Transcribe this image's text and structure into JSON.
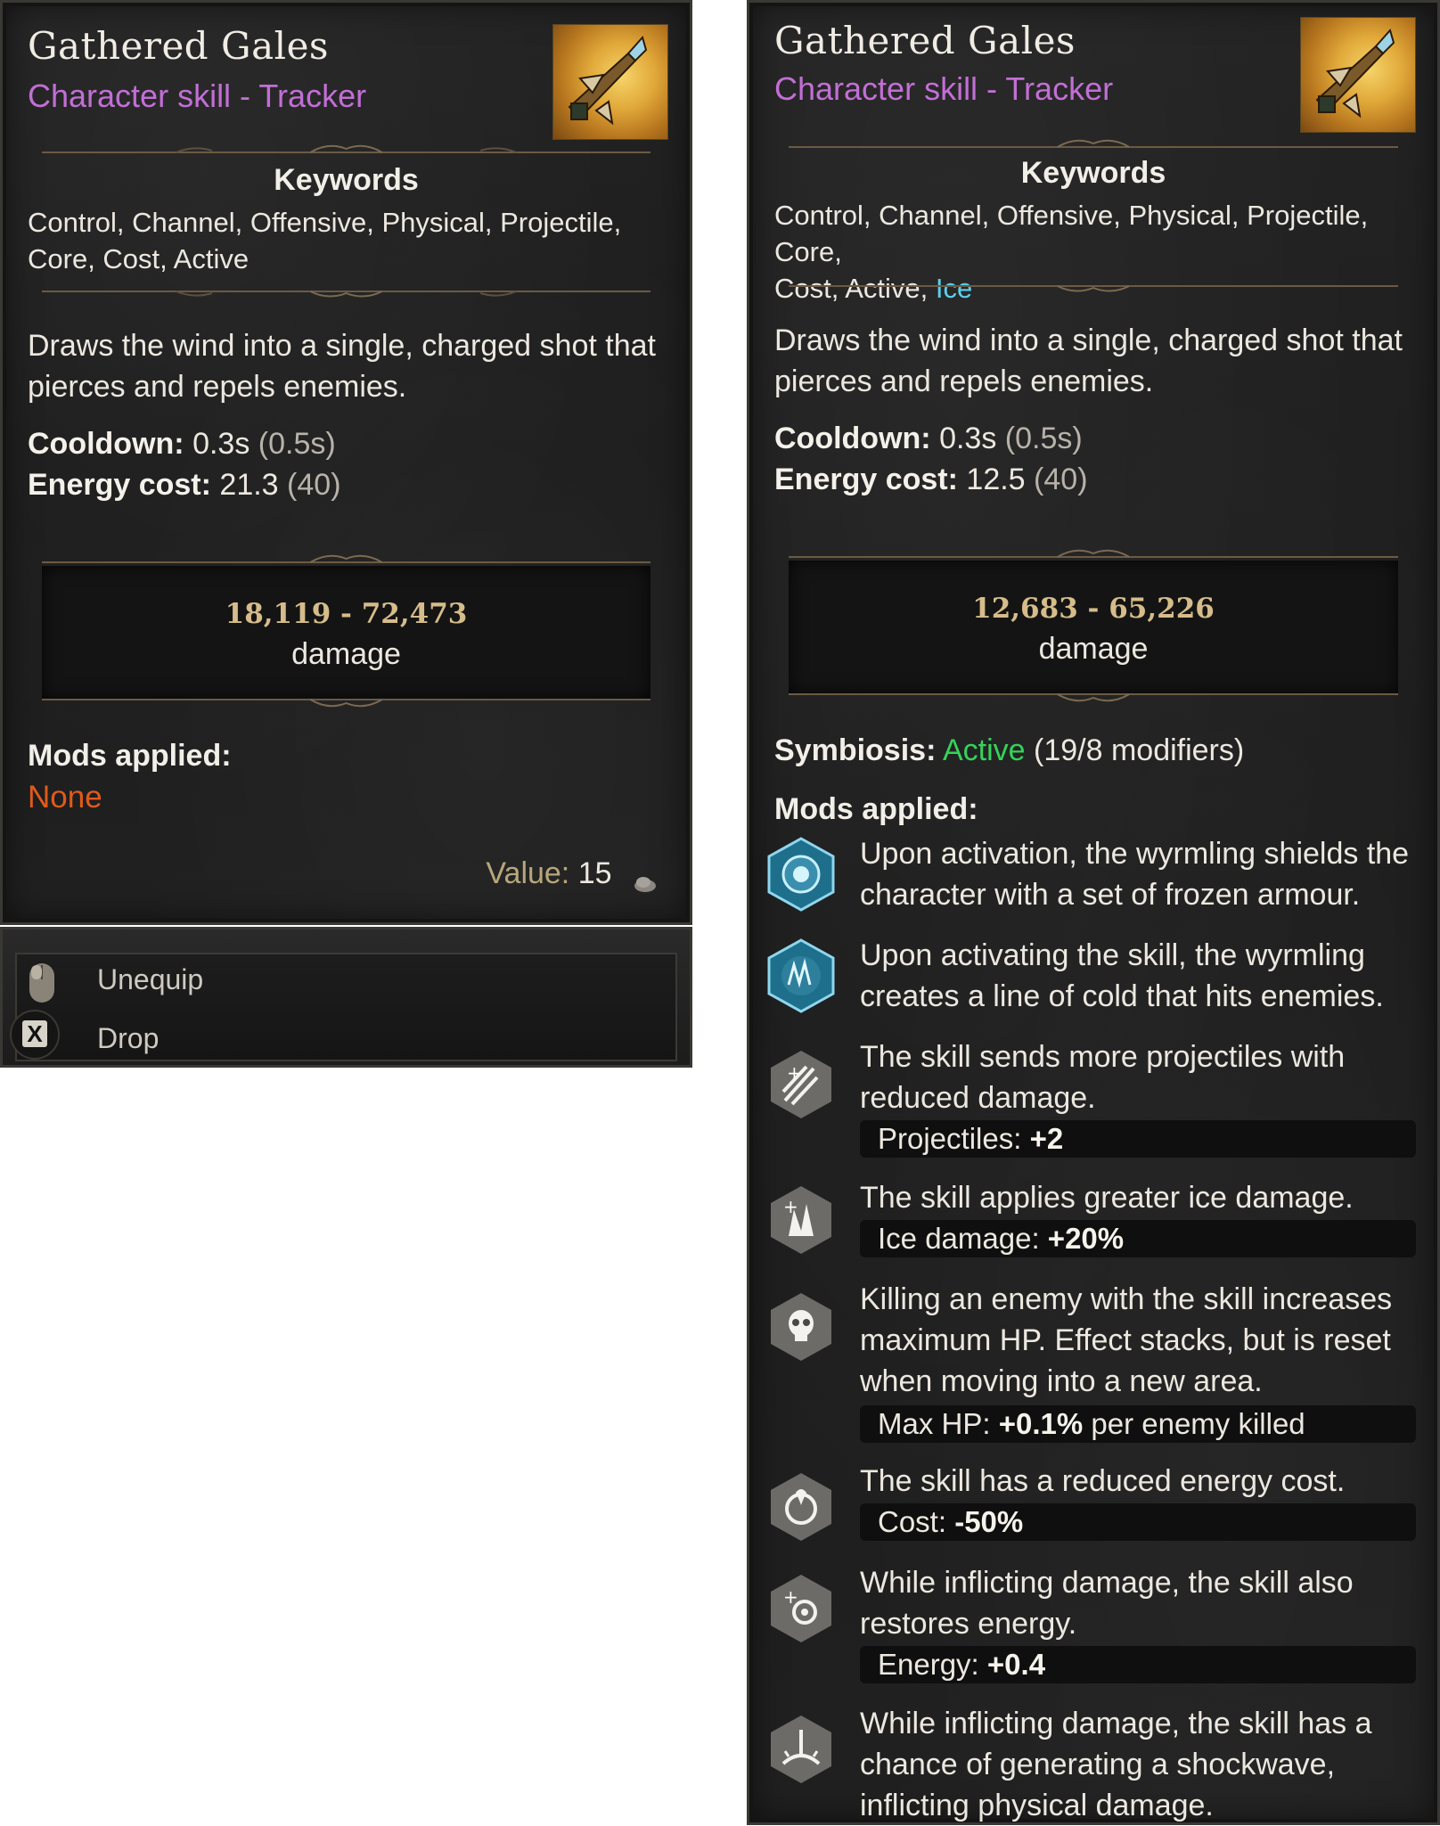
{
  "left_panel": {
    "title": "Gathered Gales",
    "subtitle": "Character skill - Tracker",
    "keywords_heading": "Keywords",
    "keywords": "Control, Channel, Offensive, Physical, Projectile, Core, Cost, Active",
    "description": "Draws the wind into a single, charged shot that pierces and repels enemies.",
    "cooldown_label": "Cooldown:",
    "cooldown_value": "0.3s",
    "cooldown_base": "(0.5s)",
    "energy_label": "Energy cost:",
    "energy_value": "21.3",
    "energy_base": "(40)",
    "damage_range": "18,119 - 72,473",
    "damage_label": "damage",
    "mods_label": "Mods applied:",
    "mods_none": "None",
    "value_label": "Value:",
    "value_amount": "15",
    "actions": [
      {
        "label": "Unequip",
        "icon": "mouse-icon"
      },
      {
        "label": "Drop",
        "icon": "x-button-icon",
        "key": "X"
      }
    ]
  },
  "right_panel": {
    "title": "Gathered Gales",
    "subtitle": "Character skill - Tracker",
    "keywords_heading": "Keywords",
    "keywords_line1": "Control, Channel, Offensive, Physical, Projectile, Core,",
    "keywords_line2": "Cost, Active, ",
    "keyword_highlight": "Ice",
    "description": "Draws the wind into a single, charged shot that pierces and repels enemies.",
    "cooldown_label": "Cooldown:",
    "cooldown_value": "0.3s",
    "cooldown_base": "(0.5s)",
    "energy_label": "Energy cost:",
    "energy_value": "12.5",
    "energy_base": "(40)",
    "damage_range": "12,683 - 65,226",
    "damage_label": "damage",
    "symbiosis_label": "Symbiosis:",
    "symbiosis_status": "Active",
    "symbiosis_detail": "(19/8 modifiers)",
    "mods_label": "Mods applied:",
    "mods": [
      {
        "icon": "frozen-armour-icon",
        "text": "Upon activation, the wyrmling shields the character with a set of frozen armour."
      },
      {
        "icon": "cold-line-icon",
        "text": "Upon activating the skill, the wyrmling creates a line of cold that hits enemies."
      },
      {
        "icon": "multi-projectile-icon",
        "text": "The skill sends more projectiles with reduced damage.",
        "stat_label": "Projectiles:",
        "stat_value": "+2",
        "stat_suffix": ""
      },
      {
        "icon": "ice-damage-icon",
        "text": "The skill applies greater ice damage.",
        "stat_label": "Ice damage:",
        "stat_value": "+20%",
        "stat_suffix": ""
      },
      {
        "icon": "skull-icon",
        "text": "Killing an enemy with the skill increases maximum HP. Effect stacks, but is reset when moving into a new area.",
        "stat_label": "Max HP:",
        "stat_value": "+0.1%",
        "stat_suffix": " per enemy killed"
      },
      {
        "icon": "energy-cost-icon",
        "text": "The skill has a reduced energy cost.",
        "stat_label": "Cost:",
        "stat_value": "-50%",
        "stat_suffix": ""
      },
      {
        "icon": "energy-restore-icon",
        "text": "While inflicting damage, the skill also restores energy.",
        "stat_label": "Energy:",
        "stat_value": "+0.4",
        "stat_suffix": ""
      },
      {
        "icon": "shockwave-icon",
        "text": "While inflicting damage, the skill has a chance of generating a shockwave, inflicting physical damage."
      }
    ]
  },
  "colors": {
    "subtitle": "#c26fd6",
    "none": "#e05a1c",
    "ice": "#5ad0ee",
    "active": "#35d35a",
    "damage": "#d6bc8a"
  }
}
